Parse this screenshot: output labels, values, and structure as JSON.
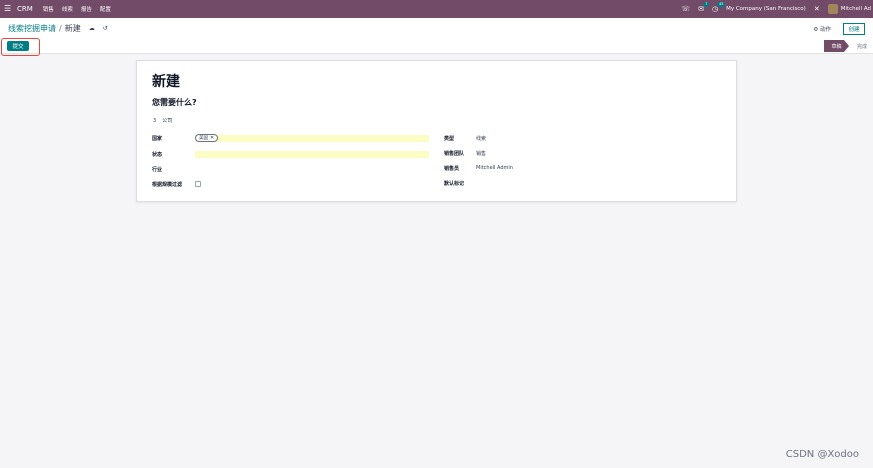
{
  "navbar": {
    "brand": "CRM",
    "menus": [
      "销售",
      "线索",
      "报告",
      "配置"
    ],
    "chat_badge": "7",
    "activity_badge": "45",
    "company": "My Company (San Francisco)",
    "user": "Mitchell Ad"
  },
  "control": {
    "breadcrumb_parent": "线索挖掘申请",
    "breadcrumb_current": "新建",
    "action_label": "⚙ 动作",
    "new_label": "创建",
    "submit_label": "提交",
    "status_draft": "草稿",
    "status_done": "完成"
  },
  "form": {
    "title": "新建",
    "subtitle": "您需要什么?",
    "count": "3",
    "count_label": "公司",
    "left": {
      "country_label": "国家",
      "country_tag": "美国",
      "state_label": "状态",
      "industry_label": "行业",
      "size_filter_label": "根据规模过滤"
    },
    "right": {
      "type_label": "类型",
      "type_value": "线索",
      "team_label": "销售团队",
      "team_value": "销售",
      "salesperson_label": "销售员",
      "salesperson_value": "Mitchell Admin",
      "tags_label": "默认标记"
    }
  },
  "watermark": "CSDN @Xodoo",
  "colors": {
    "brand": "#714b67",
    "accent": "#017e84",
    "highlight": "#e5473b"
  }
}
